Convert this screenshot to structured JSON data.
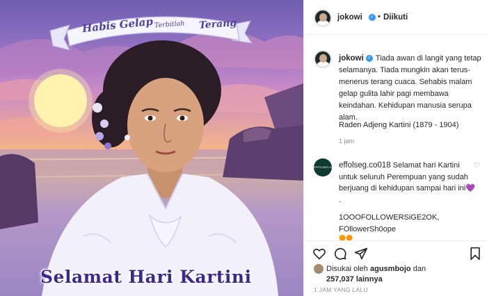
{
  "post_image": {
    "banner_word1": "Habis Gelap",
    "banner_word2": "Terbitlah",
    "banner_word3": "Terang",
    "caption_art": "Selamat Hari Kartini"
  },
  "header": {
    "username": "jokowi",
    "verified_mark": "✓",
    "separator": "•",
    "follow_status": "Diikuti"
  },
  "caption": {
    "username": "jokowi",
    "text": "Tiada awan di langit yang tetap selamanya. Tiada mungkin akan terus-menerus terang cuaca. Sehabis malam gelap gulita lahir pagi membawa keindahan. Kehidupan manusia serupa alam.",
    "quote_author": "Raden Adjeng Kartini (1879 - 1904)",
    "time": "1 jam"
  },
  "comment": {
    "avatar_text": "EFFOLSEG.CO018",
    "username": "effolseg.co018",
    "text": "Selamat hari Kartini untuk seluruh Perempuan yang sudah berjuang di kehidupan sampai hari ini",
    "emoji": "💜",
    "line_dot": ".",
    "line_followers": "1OOOFOLLOWERSiGE2OK,",
    "line_shop": "FOllowerSh0ope",
    "line_emoji": "🟠🟠"
  },
  "likes": {
    "prefix": "Disukai oleh",
    "user": "agusmbojo",
    "conj": "dan",
    "count": "257,037",
    "suffix": "lainnya"
  },
  "timeago": "1 JAM YANG LALU",
  "colors": {
    "verified": "#3897f0",
    "muted": "#8e8e8e",
    "art_text": "#3b2a8a"
  }
}
